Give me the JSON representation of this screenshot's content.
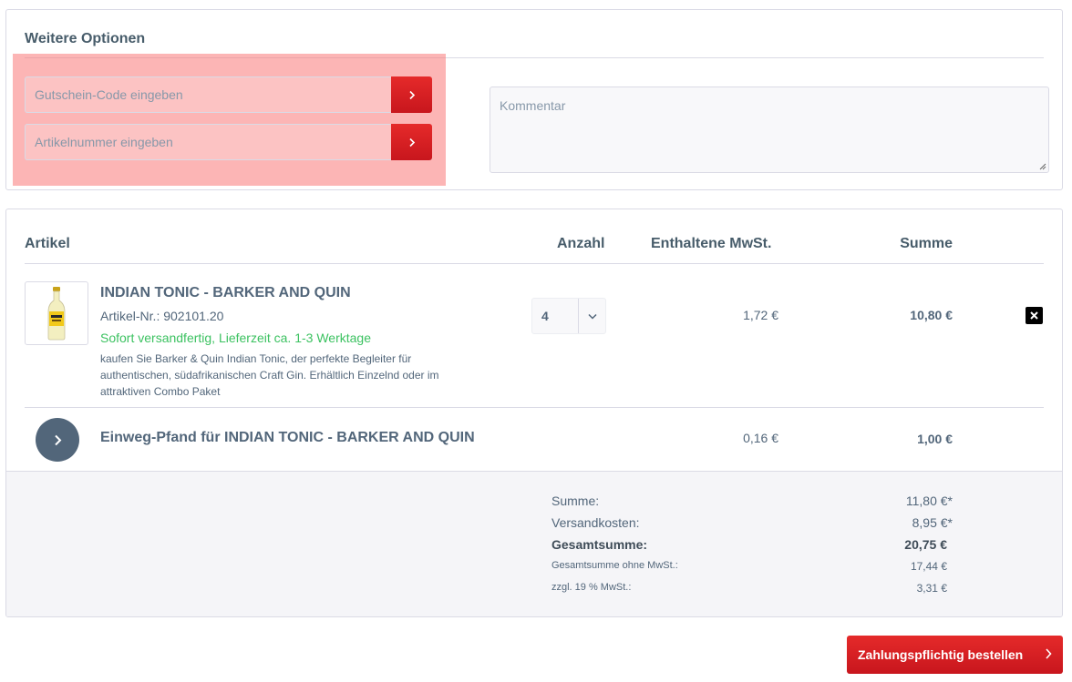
{
  "options": {
    "title": "Weitere Optionen",
    "voucher_placeholder": "Gutschein-Code eingeben",
    "article_placeholder": "Artikelnummer eingeben",
    "comment_placeholder": "Kommentar"
  },
  "cart": {
    "headers": {
      "article": "Artikel",
      "quantity": "Anzahl",
      "vat": "Enthaltene MwSt.",
      "sum": "Summe"
    },
    "item": {
      "name": "INDIAN TONIC - BARKER AND QUIN",
      "article_number": "Artikel-Nr.: 902101.20",
      "shipping": "Sofort versandfertig, Lieferzeit ca. 1-3 Werktage",
      "description": "kaufen Sie Barker & Quin Indian Tonic, der perfekte Begleiter für authentischen, südafrikanischen Craft Gin. Erhältlich Einzelnd oder im attraktiven Combo Paket",
      "quantity": "4",
      "vat": "1,72 €",
      "sum": "10,80 €"
    },
    "deposit": {
      "name": "Einweg-Pfand für INDIAN TONIC - BARKER AND QUIN",
      "vat": "0,16 €",
      "sum": "1,00 €"
    },
    "summary": {
      "subtotal_label": "Summe:",
      "subtotal": "11,80 €*",
      "shipping_label": "Versandkosten:",
      "shipping": "8,95 €*",
      "total_label": "Gesamtsumme:",
      "total": "20,75 €",
      "net_label": "Gesamtsumme ohne MwSt.:",
      "net": "17,44 €",
      "tax_label": "zzgl. 19 % MwSt.:",
      "tax": "3,31 €"
    }
  },
  "order_button": "Zahlungspflichtig bestellen",
  "colors": {
    "accent": "#d9191f",
    "text": "#52667a",
    "success": "#3cc261",
    "highlight": "#fa7878"
  }
}
